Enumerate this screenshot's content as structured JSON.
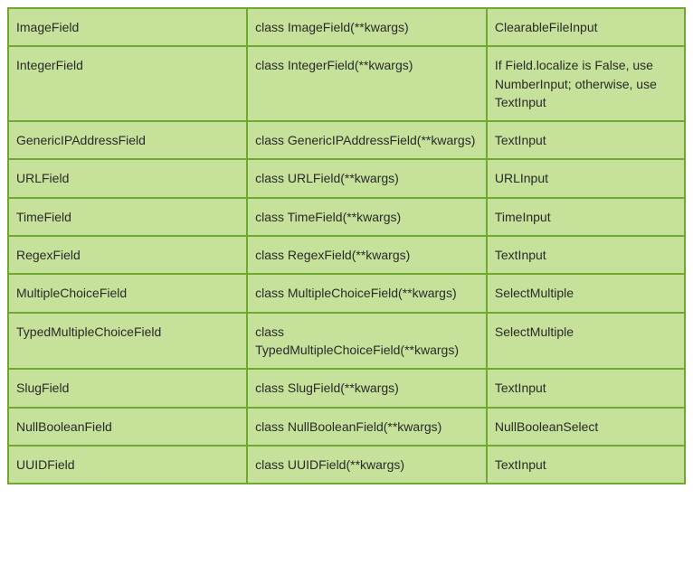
{
  "table": {
    "rows": [
      {
        "name": "ImageField",
        "class": "class ImageField(**kwargs)",
        "widget": "ClearableFileInput"
      },
      {
        "name": "IntegerField",
        "class": "class IntegerField(**kwargs)",
        "widget": "If Field.localize is False, use NumberInput; otherwise, use TextInput"
      },
      {
        "name": "GenericIPAddressField",
        "class": "class GenericIPAddressField(**kwargs)",
        "widget": "TextInput"
      },
      {
        "name": "URLField",
        "class": "class URLField(**kwargs)",
        "widget": "URLInput"
      },
      {
        "name": "TimeField",
        "class": "class TimeField(**kwargs)",
        "widget": "TimeInput"
      },
      {
        "name": "RegexField",
        "class": "class RegexField(**kwargs)",
        "widget": "TextInput"
      },
      {
        "name": "MultipleChoiceField",
        "class": "class MultipleChoiceField(**kwargs)",
        "widget": "SelectMultiple"
      },
      {
        "name": "TypedMultipleChoiceField",
        "class": "class TypedMultipleChoiceField(**kwargs)",
        "widget": "SelectMultiple"
      },
      {
        "name": "SlugField",
        "class": "class SlugField(**kwargs)",
        "widget": "TextInput"
      },
      {
        "name": "NullBooleanField",
        "class": "class NullBooleanField(**kwargs)",
        "widget": "NullBooleanSelect"
      },
      {
        "name": "UUIDField",
        "class": "class UUIDField(**kwargs)",
        "widget": "TextInput"
      }
    ]
  }
}
